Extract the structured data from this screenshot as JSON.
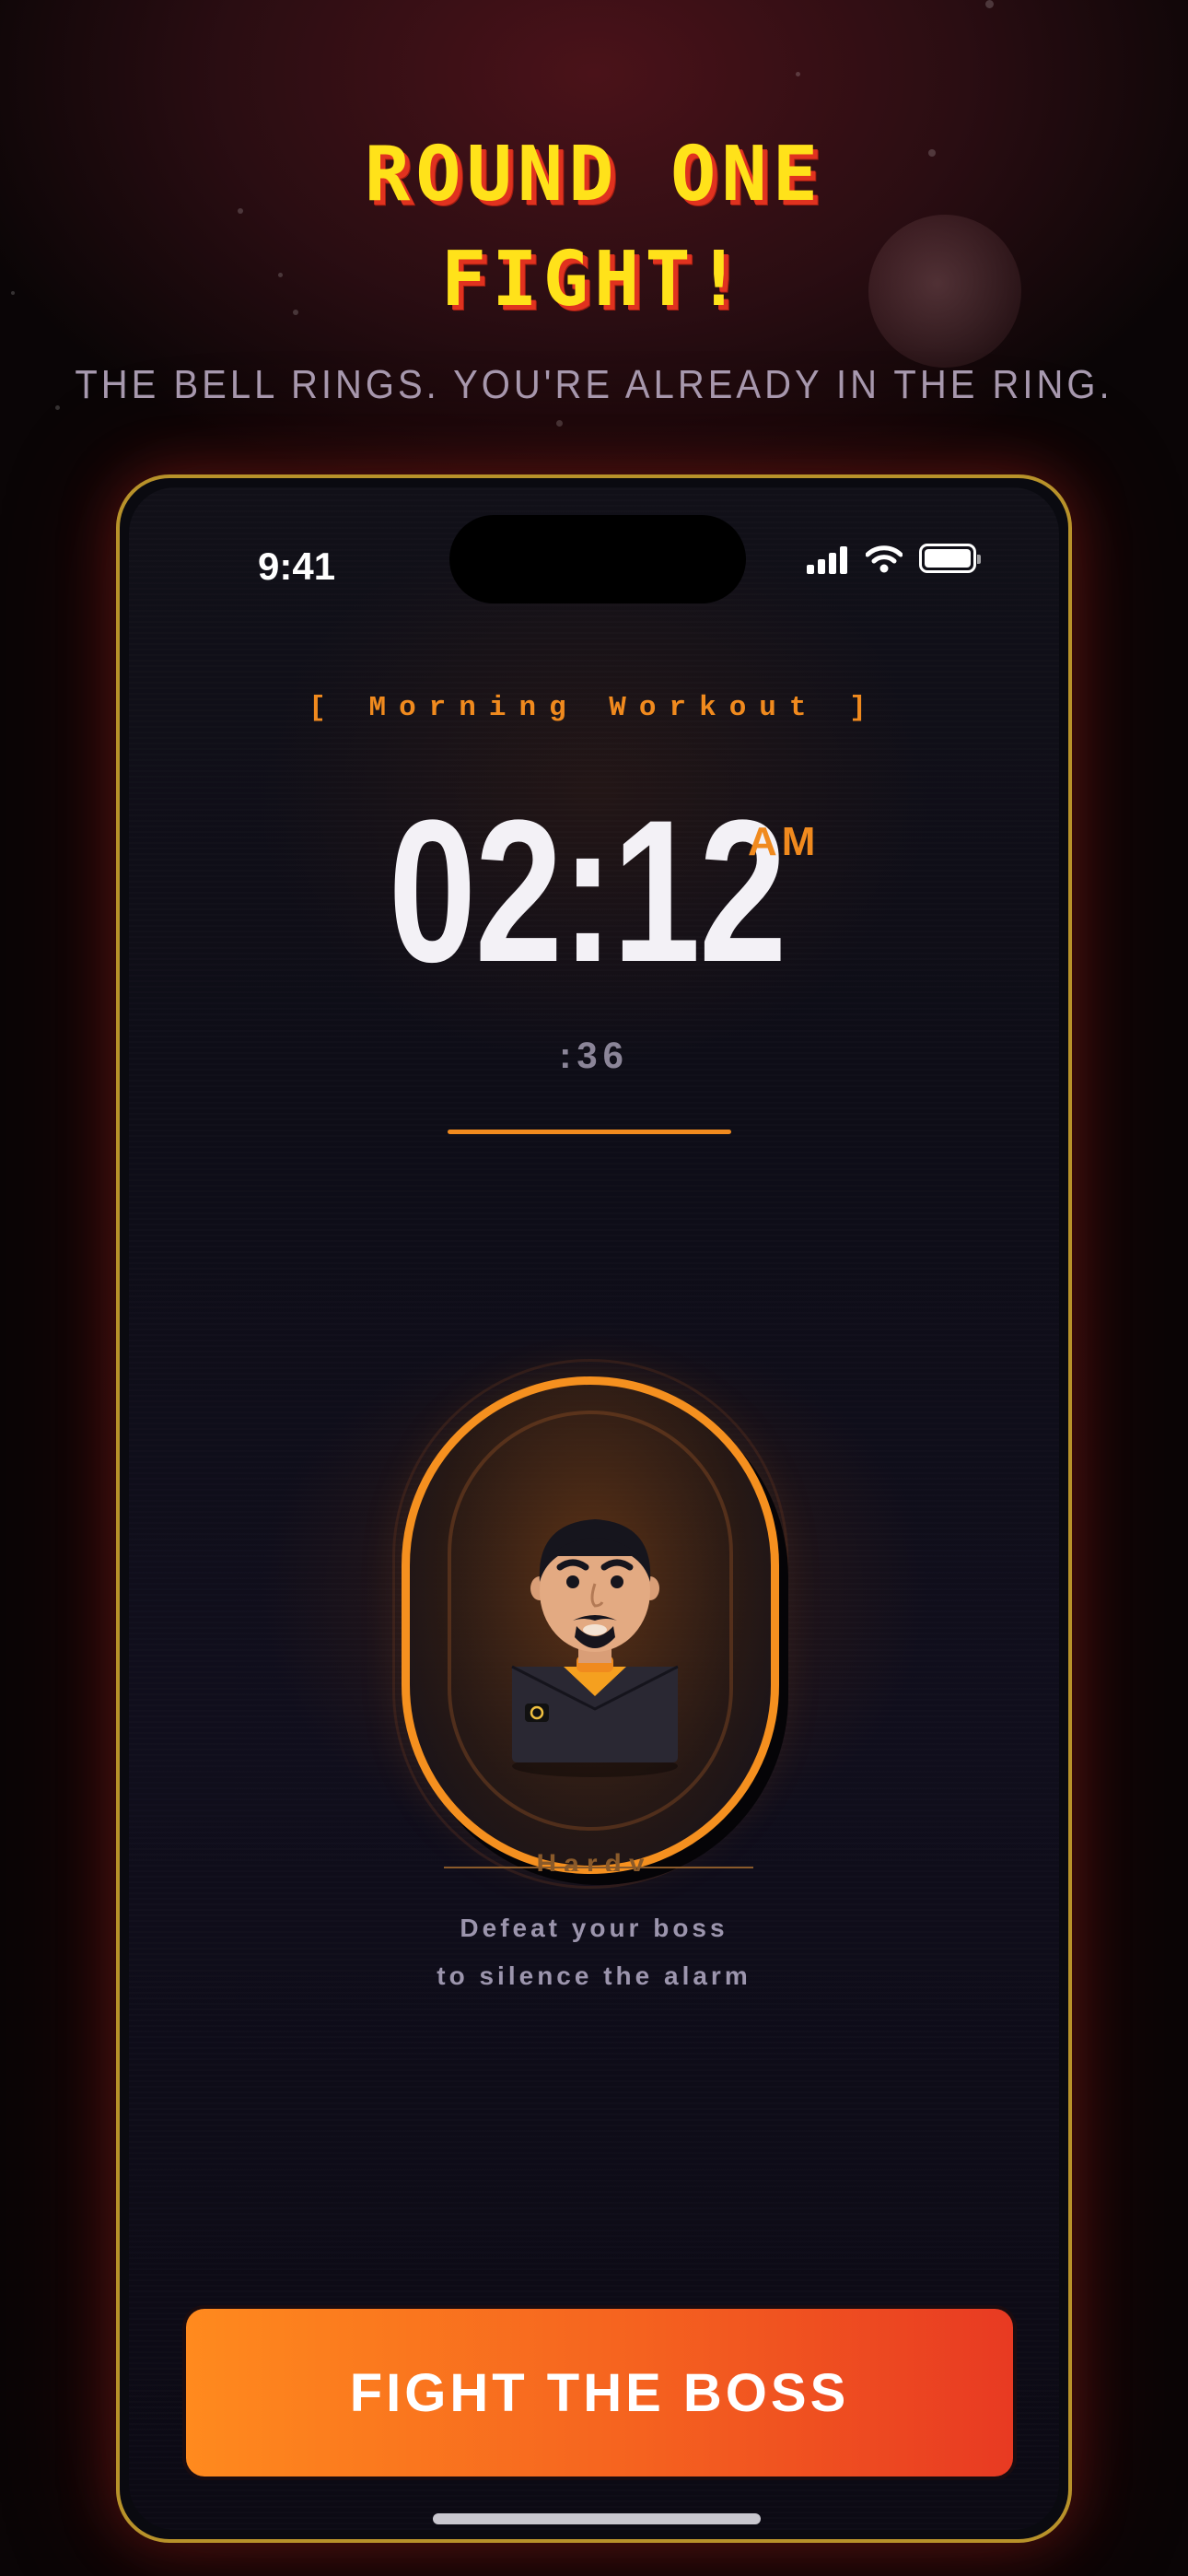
{
  "hero": {
    "title_line1": "ROUND ONE",
    "title_line2": "FIGHT!",
    "tagline": "THE BELL RINGS. YOU'RE ALREADY IN THE RING."
  },
  "status_bar": {
    "time": "9:41",
    "icons": [
      "signal-icon",
      "wifi-icon",
      "battery-icon"
    ]
  },
  "alarm": {
    "label": "[ Morning Workout ]",
    "time": "02:12",
    "meridiem": "AM",
    "seconds": ":36"
  },
  "boss": {
    "name": "Hardy",
    "hint_line1": "Defeat your boss",
    "hint_line2": "to silence the alarm"
  },
  "actions": {
    "fight_label": "FIGHT THE BOSS"
  },
  "colors": {
    "accent": "#f08a1e",
    "title_yellow": "#ffe21a",
    "title_shadow": "#e0321f",
    "frame_gold": "#b8922a",
    "button_start": "#ff8a1e",
    "button_end": "#e83a22"
  }
}
